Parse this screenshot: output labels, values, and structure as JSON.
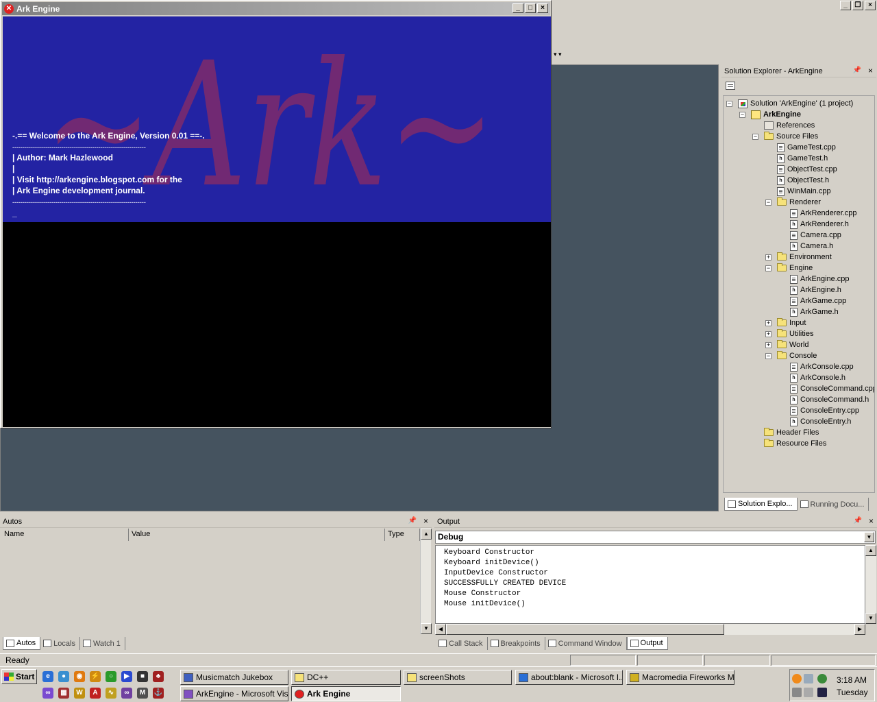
{
  "ide": {
    "solution_explorer": {
      "title": "Solution Explorer - ArkEngine",
      "tree": [
        {
          "label": "Solution 'ArkEngine' (1 project)",
          "icon": "solution-icon",
          "depth": 0,
          "expander": "minus"
        },
        {
          "label": "ArkEngine",
          "icon": "project-icon",
          "depth": 1,
          "expander": "minus",
          "bold": true
        },
        {
          "label": "References",
          "icon": "references-icon",
          "depth": 2,
          "expander": "none"
        },
        {
          "label": "Source Files",
          "icon": "folder-open-icon",
          "depth": 2,
          "expander": "minus"
        },
        {
          "label": "GameTest.cpp",
          "icon": "cpp-file-icon",
          "depth": 3,
          "expander": "none"
        },
        {
          "label": "GameTest.h",
          "icon": "h-file-icon",
          "depth": 3,
          "expander": "none"
        },
        {
          "label": "ObjectTest.cpp",
          "icon": "cpp-file-icon",
          "depth": 3,
          "expander": "none"
        },
        {
          "label": "ObjectTest.h",
          "icon": "h-file-icon",
          "depth": 3,
          "expander": "none"
        },
        {
          "label": "WinMain.cpp",
          "icon": "cpp-file-icon",
          "depth": 3,
          "expander": "none"
        },
        {
          "label": "Renderer",
          "icon": "folder-open-icon",
          "depth": 3,
          "expander": "minus"
        },
        {
          "label": "ArkRenderer.cpp",
          "icon": "cpp-file-icon",
          "depth": 4,
          "expander": "none"
        },
        {
          "label": "ArkRenderer.h",
          "icon": "h-file-icon",
          "depth": 4,
          "expander": "none"
        },
        {
          "label": "Camera.cpp",
          "icon": "cpp-file-icon",
          "depth": 4,
          "expander": "none"
        },
        {
          "label": "Camera.h",
          "icon": "h-file-icon",
          "depth": 4,
          "expander": "none"
        },
        {
          "label": "Environment",
          "icon": "folder-icon",
          "depth": 3,
          "expander": "plus"
        },
        {
          "label": "Engine",
          "icon": "folder-open-icon",
          "depth": 3,
          "expander": "minus"
        },
        {
          "label": "ArkEngine.cpp",
          "icon": "cpp-file-icon",
          "depth": 4,
          "expander": "none"
        },
        {
          "label": "ArkEngine.h",
          "icon": "h-file-icon",
          "depth": 4,
          "expander": "none"
        },
        {
          "label": "ArkGame.cpp",
          "icon": "cpp-file-icon",
          "depth": 4,
          "expander": "none"
        },
        {
          "label": "ArkGame.h",
          "icon": "h-file-icon",
          "depth": 4,
          "expander": "none"
        },
        {
          "label": "Input",
          "icon": "folder-icon",
          "depth": 3,
          "expander": "plus"
        },
        {
          "label": "Utilities",
          "icon": "folder-icon",
          "depth": 3,
          "expander": "plus"
        },
        {
          "label": "World",
          "icon": "folder-icon",
          "depth": 3,
          "expander": "plus"
        },
        {
          "label": "Console",
          "icon": "folder-open-icon",
          "depth": 3,
          "expander": "minus"
        },
        {
          "label": "ArkConsole.cpp",
          "icon": "cpp-file-icon",
          "depth": 4,
          "expander": "none"
        },
        {
          "label": "ArkConsole.h",
          "icon": "h-file-icon",
          "depth": 4,
          "expander": "none"
        },
        {
          "label": "ConsoleCommand.cpp",
          "icon": "cpp-file-icon",
          "depth": 4,
          "expander": "none"
        },
        {
          "label": "ConsoleCommand.h",
          "icon": "h-file-icon",
          "depth": 4,
          "expander": "none"
        },
        {
          "label": "ConsoleEntry.cpp",
          "icon": "cpp-file-icon",
          "depth": 4,
          "expander": "none"
        },
        {
          "label": "ConsoleEntry.h",
          "icon": "h-file-icon",
          "depth": 4,
          "expander": "none"
        },
        {
          "label": "Header Files",
          "icon": "folder-icon",
          "depth": 2,
          "expander": "none"
        },
        {
          "label": "Resource Files",
          "icon": "folder-icon",
          "depth": 2,
          "expander": "none"
        }
      ],
      "tabs": [
        {
          "label": "Solution Explo...",
          "active": true
        },
        {
          "label": "Running Docu...",
          "active": false
        }
      ]
    },
    "autos": {
      "title": "Autos",
      "columns": [
        "Name",
        "Value",
        "Type"
      ],
      "tabs": [
        {
          "label": "Autos",
          "active": true
        },
        {
          "label": "Locals",
          "active": false
        },
        {
          "label": "Watch 1",
          "active": false
        }
      ]
    },
    "output": {
      "title": "Output",
      "pane": "Debug",
      "lines": [
        "Keyboard Constructor",
        "Keyboard initDevice()",
        "InputDevice Constructor",
        "SUCCESSFULLY CREATED DEVICE",
        "Mouse Constructor",
        "Mouse initDevice()"
      ],
      "tabs": [
        {
          "label": "Call Stack",
          "active": false
        },
        {
          "label": "Breakpoints",
          "active": false
        },
        {
          "label": "Command Window",
          "active": false
        },
        {
          "label": "Output",
          "active": true
        }
      ]
    },
    "status": "Ready"
  },
  "ark_window": {
    "title": "Ark Engine",
    "logo_text": "~Ark~",
    "console_lines": [
      "-.== Welcome to the Ark Engine, Version 0.01 ==-.",
      "| Author: Mark Hazlewood",
      "|",
      "| Visit http://arkengine.blogspot.com for the",
      "| Ark Engine development journal.",
      "_"
    ],
    "separator": "-----------------------------------------------------------------",
    "colors": {
      "console_bg": "#2323a3",
      "logo": "#7a2a6e"
    }
  },
  "taskbar": {
    "start_label": "Start",
    "buttons": [
      {
        "label": "Musicmatch Jukebox",
        "icon": "musicmatch-icon",
        "active": false
      },
      {
        "label": "DC++",
        "icon": "folder-icon",
        "active": false
      },
      {
        "label": "screenShots",
        "icon": "folder-icon",
        "active": false
      },
      {
        "label": "about:blank - Microsoft I...",
        "icon": "ie-icon",
        "active": false
      },
      {
        "label": "Macromedia Fireworks M...",
        "icon": "fireworks-icon",
        "active": false
      },
      {
        "label": "ArkEngine - Microsoft Vis...",
        "icon": "visual-studio-icon",
        "active": false
      },
      {
        "label": "Ark Engine",
        "icon": "ark-engine-icon",
        "active": true
      }
    ],
    "clock": "3:18 AM",
    "day": "Tuesday"
  }
}
